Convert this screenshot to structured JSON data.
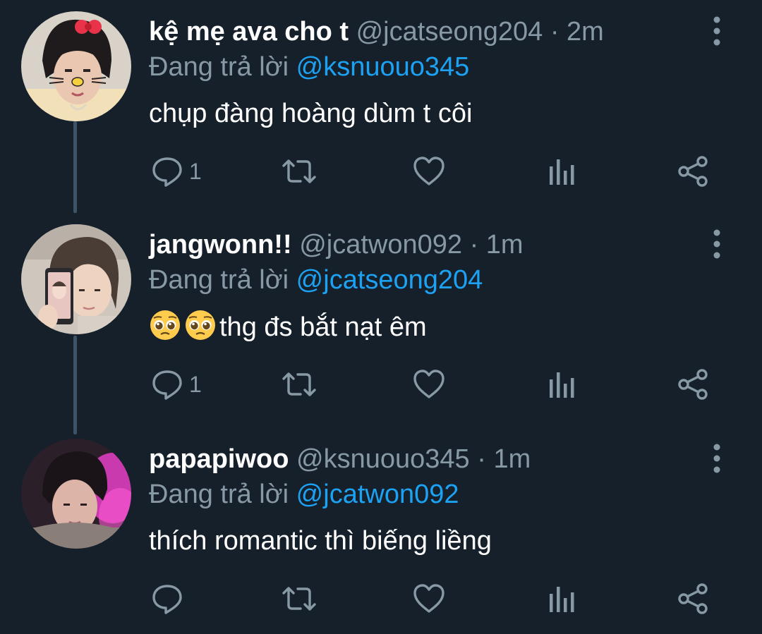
{
  "colors": {
    "background": "#15202b",
    "text_primary": "#ffffff",
    "text_secondary": "#8899a6",
    "mention": "#1da1f2",
    "thread_line": "#3d5466"
  },
  "tweets": [
    {
      "display_name": "kệ mẹ ava cho t",
      "handle": "@jcatseong204",
      "separator": "·",
      "time": "2m",
      "replying_prefix": "Đang trả lời",
      "replying_to": "@ksnuouo345",
      "text": "chụp đàng hoàng dùm t côi",
      "emoji_count": 0,
      "reply_count": "1",
      "avatar_icon": "avatar-hello-kitty-filter"
    },
    {
      "display_name": "jangwonn!!",
      "handle": "@jcatwon092",
      "separator": "·",
      "time": "1m",
      "replying_prefix": "Đang trả lời",
      "replying_to": "@jcatseong204",
      "text": "thg đs bắt nạt êm",
      "emoji_count": 2,
      "emoji_icon": "pleading-face-emoji",
      "reply_count": "1",
      "avatar_icon": "avatar-phone-selfie"
    },
    {
      "display_name": "papapiwoo",
      "handle": "@ksnuouo345",
      "separator": "·",
      "time": "1m",
      "replying_prefix": "Đang trả lời",
      "replying_to": "@jcatwon092",
      "text": "thích romantic thì biếng liềng",
      "emoji_count": 0,
      "reply_count": "",
      "avatar_icon": "avatar-pink-light"
    }
  ],
  "icons": {
    "reply": "reply-icon",
    "retweet": "retweet-icon",
    "like": "heart-icon",
    "analytics": "analytics-icon",
    "share": "share-icon",
    "more": "more-vertical-icon"
  }
}
